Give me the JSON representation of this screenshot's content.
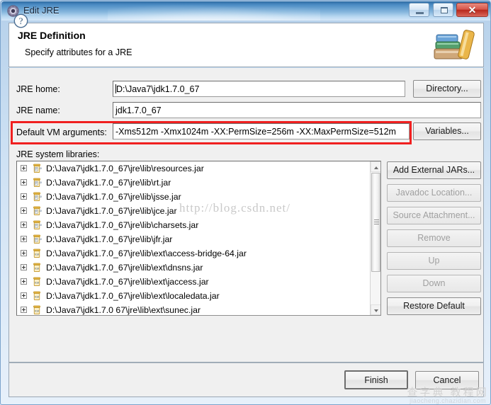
{
  "window": {
    "title": "Edit JRE",
    "icon": "jre-gear-icon",
    "buttons": {
      "minimize": "minimize-button",
      "maximize": "maximize-button",
      "close_label": "✕"
    }
  },
  "header": {
    "title": "JRE Definition",
    "subtitle": "Specify attributes for a JRE",
    "icon": "books-icon"
  },
  "form": {
    "jre_home": {
      "label": "JRE home:",
      "value": "D:\\Java7\\jdk1.7.0_67",
      "button": "Directory..."
    },
    "jre_name": {
      "label": "JRE name:",
      "value": "jdk1.7.0_67"
    },
    "vm_args": {
      "label": "Default VM arguments:",
      "value": "-Xms512m  -Xmx1024m  -XX:PermSize=256m -XX:MaxPermSize=512m",
      "button": "Variables...",
      "highlight_color": "#f02020"
    },
    "libraries_label": "JRE system libraries:"
  },
  "libraries": [
    {
      "path": "D:\\Java7\\jdk1.7.0_67\\jre\\lib\\resources.jar",
      "icon": "jar-doc-icon"
    },
    {
      "path": "D:\\Java7\\jdk1.7.0_67\\jre\\lib\\rt.jar",
      "icon": "jar-doc-icon"
    },
    {
      "path": "D:\\Java7\\jdk1.7.0_67\\jre\\lib\\jsse.jar",
      "icon": "jar-doc-icon"
    },
    {
      "path": "D:\\Java7\\jdk1.7.0_67\\jre\\lib\\jce.jar",
      "icon": "jar-doc-icon"
    },
    {
      "path": "D:\\Java7\\jdk1.7.0_67\\jre\\lib\\charsets.jar",
      "icon": "jar-doc-icon"
    },
    {
      "path": "D:\\Java7\\jdk1.7.0_67\\jre\\lib\\jfr.jar",
      "icon": "jar-doc-icon"
    },
    {
      "path": "D:\\Java7\\jdk1.7.0_67\\jre\\lib\\ext\\access-bridge-64.jar",
      "icon": "jar-icon"
    },
    {
      "path": "D:\\Java7\\jdk1.7.0_67\\jre\\lib\\ext\\dnsns.jar",
      "icon": "jar-icon"
    },
    {
      "path": "D:\\Java7\\jdk1.7.0_67\\jre\\lib\\ext\\jaccess.jar",
      "icon": "jar-icon"
    },
    {
      "path": "D:\\Java7\\jdk1.7.0_67\\jre\\lib\\ext\\localedata.jar",
      "icon": "jar-icon"
    },
    {
      "path": "D:\\Java7\\jdk1.7.0 67\\jre\\lib\\ext\\sunec.jar",
      "icon": "jar-icon"
    }
  ],
  "side_buttons": [
    {
      "label": "Add External JARs...",
      "enabled": true
    },
    {
      "label": "Javadoc Location...",
      "enabled": false
    },
    {
      "label": "Source Attachment...",
      "enabled": false
    },
    {
      "label": "Remove",
      "enabled": false
    },
    {
      "label": "Up",
      "enabled": false
    },
    {
      "label": "Down",
      "enabled": false
    },
    {
      "label": "Restore Default",
      "enabled": true
    }
  ],
  "footer": {
    "help_icon": "help-question-icon",
    "finish": "Finish",
    "cancel": "Cancel"
  },
  "watermarks": {
    "url": "http://blog.csdn.net/",
    "site_cn": "查字典 教程网",
    "site_en": "jiaocheng.chazidian.com"
  }
}
